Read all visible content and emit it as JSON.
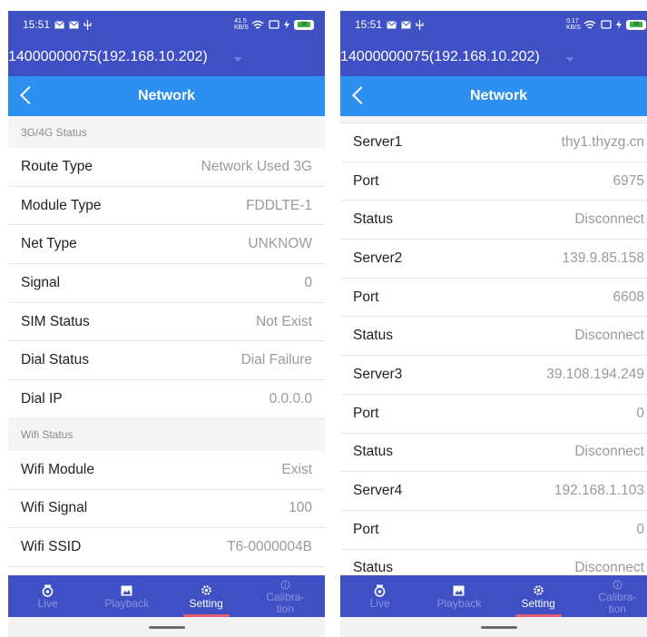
{
  "left": {
    "status_bar": {
      "time": "15:51",
      "speed_top": "41.5",
      "speed_bottom": "KB/S",
      "battery": "38"
    },
    "device": {
      "title": "14000000075(192.168.10.202)"
    },
    "header": {
      "title": "Network"
    },
    "sections": [
      {
        "title": "3G/4G Status",
        "rows": [
          {
            "label": "Route Type",
            "value": "Network Used 3G"
          },
          {
            "label": "Module Type",
            "value": "FDDLTE-1"
          },
          {
            "label": "Net Type",
            "value": "UNKNOW"
          },
          {
            "label": "Signal",
            "value": "0"
          },
          {
            "label": "SIM Status",
            "value": "Not Exist"
          },
          {
            "label": "Dial Status",
            "value": "Dial Failure"
          },
          {
            "label": "Dial IP",
            "value": "0.0.0.0"
          }
        ]
      },
      {
        "title": "Wifi Status",
        "rows": [
          {
            "label": "Wifi Module",
            "value": "Exist"
          },
          {
            "label": "Wifi Signal",
            "value": "100"
          },
          {
            "label": "Wifi SSID",
            "value": "T6-0000004B"
          }
        ]
      }
    ],
    "tabs": [
      {
        "label": "Live",
        "icon": "camera-icon"
      },
      {
        "label": "Playback",
        "icon": "image-icon"
      },
      {
        "label": "Setting",
        "icon": "gear-icon",
        "active": true
      },
      {
        "label": "Calibra-\ntion",
        "icon": "info-icon"
      }
    ]
  },
  "right": {
    "status_bar": {
      "time": "15:51",
      "speed_top": "0.17",
      "speed_bottom": "KB/S",
      "battery": "38"
    },
    "device": {
      "title": "14000000075(192.168.10.202)"
    },
    "header": {
      "title": "Network"
    },
    "rows": [
      {
        "label": "Server1",
        "value": "thy1.thyzg.cn"
      },
      {
        "label": "Port",
        "value": "6975"
      },
      {
        "label": "Status",
        "value": "Disconnect"
      },
      {
        "label": "Server2",
        "value": "139.9.85.158"
      },
      {
        "label": "Port",
        "value": "6608"
      },
      {
        "label": "Status",
        "value": "Disconnect"
      },
      {
        "label": "Server3",
        "value": "39.108.194.249"
      },
      {
        "label": "Port",
        "value": "0"
      },
      {
        "label": "Status",
        "value": "Disconnect"
      },
      {
        "label": "Server4",
        "value": "192.168.1.103"
      },
      {
        "label": "Port",
        "value": "0"
      },
      {
        "label": "Status",
        "value": "Disconnect"
      }
    ],
    "tabs": [
      {
        "label": "Live",
        "icon": "camera-icon"
      },
      {
        "label": "Playback",
        "icon": "image-icon"
      },
      {
        "label": "Setting",
        "icon": "gear-icon",
        "active": true
      },
      {
        "label": "Calibra-\ntion",
        "icon": "info-icon"
      }
    ]
  },
  "colors": {
    "primary": "#3f4fc4",
    "header": "#2d8fef",
    "inactive_tab": "#8a94e0",
    "indicator": "#e35b75"
  }
}
